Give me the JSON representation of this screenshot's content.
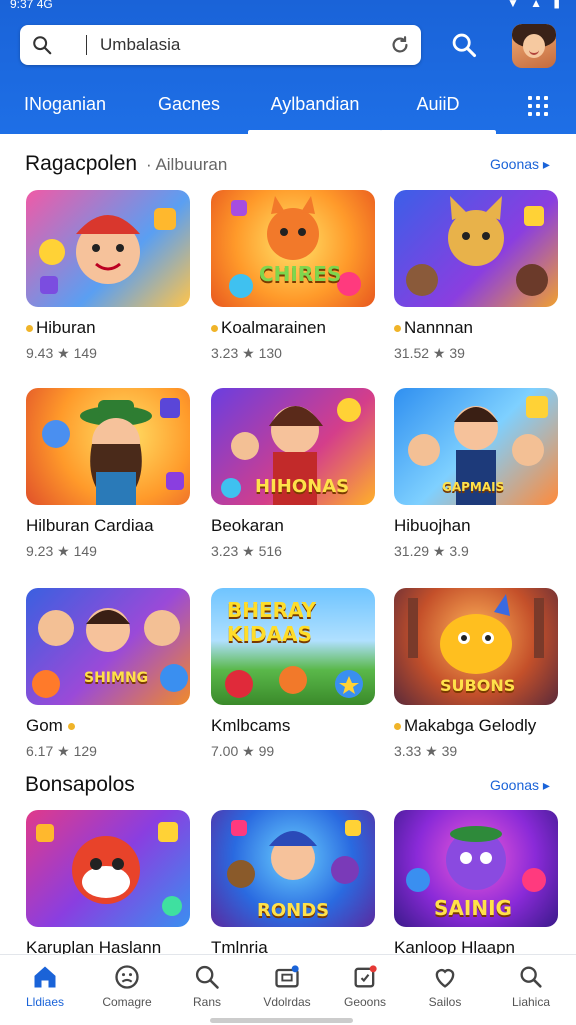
{
  "status": {
    "time": "9:37 4G",
    "icons": "▼ ▲ ▮"
  },
  "search": {
    "value": "Umbalasia"
  },
  "tabs": [
    {
      "label": "INoganian"
    },
    {
      "label": "Gacnes"
    },
    {
      "label": "Aylbandian"
    },
    {
      "label": "AuiiD"
    }
  ],
  "section1": {
    "title": "Ragacpolen",
    "subtitle": "· Ailbuuran",
    "more": "Goonas ▸"
  },
  "section2": {
    "title": "Bonsapolos",
    "more": "Goonas ▸"
  },
  "games": [
    {
      "title": "Hiburan",
      "meta": "9.43 ★ 149",
      "dot": true
    },
    {
      "title": "Koalmarainen",
      "meta": "3.23 ★ 130",
      "dot": true
    },
    {
      "title": "Nannnan",
      "meta": "31.52 ★ 39",
      "dot": true
    },
    {
      "title": "Hilburan Cardiaa",
      "meta": "9.23 ★ 149",
      "dot": false
    },
    {
      "title": "Beokaran",
      "meta": "3.23 ★ 516",
      "dot": false
    },
    {
      "title": "Hibuojhan",
      "meta": "31.29 ★ 3.9",
      "dot": false
    },
    {
      "title": "Gom",
      "meta": "6.17 ★ 129",
      "dot": false
    },
    {
      "title": "Kmlbcams",
      "meta": "7.00 ★ 99",
      "dot": false
    },
    {
      "title": "Makabga Gelodly",
      "meta": "3.33 ★ 39",
      "dot": true
    },
    {
      "title": "Karuplan Haslann",
      "meta": "",
      "dot": false
    },
    {
      "title": "Tmlnria",
      "meta": "",
      "dot": false
    },
    {
      "title": "Kanloop Hlaapn",
      "meta": "",
      "dot": false
    }
  ],
  "thumb_logos": {
    "g2": "CHIRES",
    "g5": "HIHONAS",
    "g6": "GAPMAIS",
    "g7": "SHIMNG",
    "g8": "BHERAY KIDAAS",
    "g9": "SUBONS",
    "g11": "RONDS",
    "g12": "SAINIG"
  },
  "bottom_nav": [
    {
      "label": "Lldiaes",
      "icon": "home-icon"
    },
    {
      "label": "Comagre",
      "icon": "face-icon"
    },
    {
      "label": "Rans",
      "icon": "search-icon"
    },
    {
      "label": "Vdolrdas",
      "icon": "gamepad-icon"
    },
    {
      "label": "Geoons",
      "icon": "edit-icon"
    },
    {
      "label": "Sailos",
      "icon": "heart-icon"
    },
    {
      "label": "Liahica",
      "icon": "account-search-icon"
    }
  ],
  "colors": {
    "primary": "#1a63d8",
    "accent": "#f0b429"
  }
}
